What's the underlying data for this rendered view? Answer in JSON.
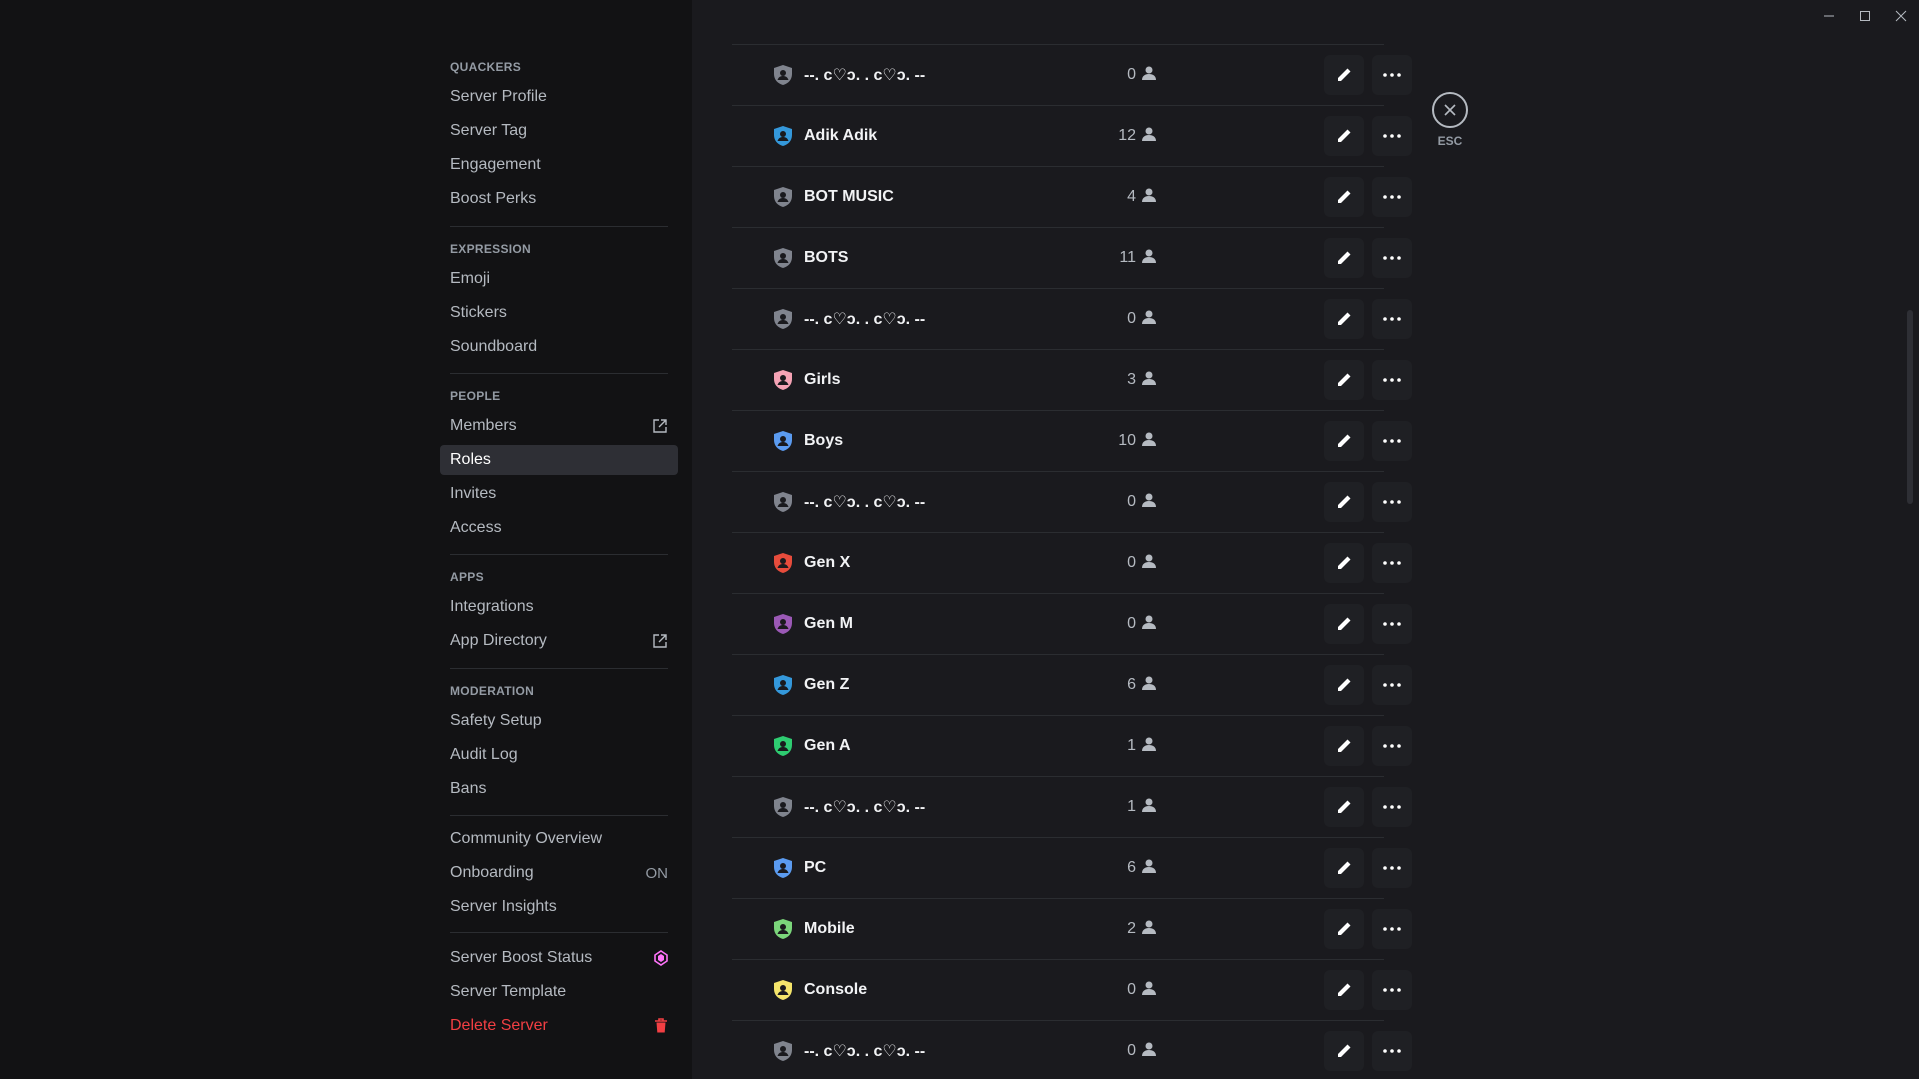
{
  "sidebar": {
    "sections": [
      {
        "header": "QUACKERS",
        "items": [
          {
            "label": "Server Profile"
          },
          {
            "label": "Server Tag"
          },
          {
            "label": "Engagement"
          },
          {
            "label": "Boost Perks"
          }
        ]
      },
      {
        "header": "EXPRESSION",
        "items": [
          {
            "label": "Emoji"
          },
          {
            "label": "Stickers"
          },
          {
            "label": "Soundboard"
          }
        ]
      },
      {
        "header": "PEOPLE",
        "items": [
          {
            "label": "Members",
            "icon": "external-link-icon"
          },
          {
            "label": "Roles",
            "active": true
          },
          {
            "label": "Invites"
          },
          {
            "label": "Access"
          }
        ]
      },
      {
        "header": "APPS",
        "items": [
          {
            "label": "Integrations"
          },
          {
            "label": "App Directory",
            "icon": "external-link-icon"
          }
        ]
      },
      {
        "header": "MODERATION",
        "items": [
          {
            "label": "Safety Setup"
          },
          {
            "label": "Audit Log"
          },
          {
            "label": "Bans"
          }
        ]
      },
      {
        "header": "",
        "items": [
          {
            "label": "Community Overview"
          },
          {
            "label": "Onboarding",
            "status": "ON"
          },
          {
            "label": "Server Insights"
          }
        ]
      },
      {
        "header": "",
        "items": [
          {
            "label": "Server Boost Status",
            "icon": "boost-gem-icon"
          },
          {
            "label": "Server Template"
          },
          {
            "label": "Delete Server",
            "icon": "trash-icon",
            "danger": true
          }
        ]
      }
    ]
  },
  "roles": [
    {
      "name": "--. c♡ɔ. . c♡ɔ. --",
      "count": "0",
      "color": "#80848e"
    },
    {
      "name": "Adik Adik",
      "count": "12",
      "color": "#3498db"
    },
    {
      "name": "BOT MUSIC",
      "count": "4",
      "color": "#80848e"
    },
    {
      "name": "BOTS",
      "count": "11",
      "color": "#80848e"
    },
    {
      "name": "--. c♡ɔ. . c♡ɔ. --",
      "count": "0",
      "color": "#80848e"
    },
    {
      "name": "Girls",
      "count": "3",
      "color": "#f5a3b5"
    },
    {
      "name": "Boys",
      "count": "10",
      "color": "#5b9bf0"
    },
    {
      "name": "--. c♡ɔ. . c♡ɔ. --",
      "count": "0",
      "color": "#80848e"
    },
    {
      "name": "Gen X",
      "count": "0",
      "color": "#e74c3c"
    },
    {
      "name": "Gen M",
      "count": "0",
      "color": "#9b59b6"
    },
    {
      "name": "Gen Z",
      "count": "6",
      "color": "#3498db"
    },
    {
      "name": "Gen A",
      "count": "1",
      "color": "#2ecc71"
    },
    {
      "name": "--. c♡ɔ. . c♡ɔ. --",
      "count": "1",
      "color": "#80848e"
    },
    {
      "name": "PC",
      "count": "6",
      "color": "#5b9bf0"
    },
    {
      "name": "Mobile",
      "count": "2",
      "color": "#7bd67b"
    },
    {
      "name": "Console",
      "count": "0",
      "color": "#f5e56b"
    },
    {
      "name": "--. c♡ɔ. . c♡ɔ. --",
      "count": "0",
      "color": "#80848e"
    }
  ],
  "close": {
    "label": "ESC"
  },
  "colors": {
    "danger": "#f23f43",
    "boost": "#ff73fa"
  }
}
